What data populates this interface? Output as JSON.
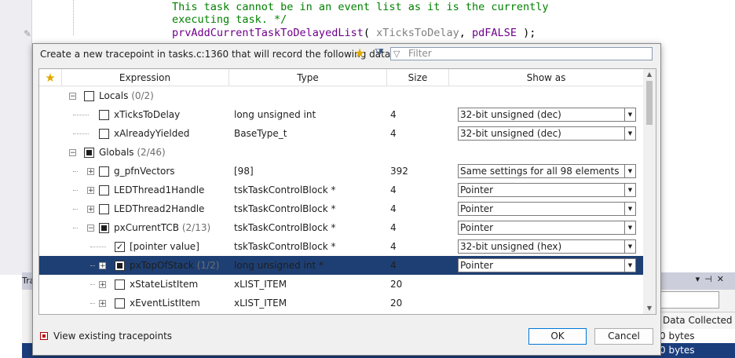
{
  "editor": {
    "lines": [
      {
        "parts": [
          {
            "t": "This task cannot be in an event list as it is the currently",
            "c": "c-comment"
          }
        ]
      },
      {
        "parts": [
          {
            "t": "executing task. */",
            "c": "c-comment"
          }
        ]
      },
      {
        "parts": [
          {
            "t": "prvAddCurrentTaskToDelayedList",
            "c": "c-fn"
          },
          {
            "t": "( ",
            "c": "c-punc"
          },
          {
            "t": "xTicksToDelay",
            "c": "c-param"
          },
          {
            "t": ", ",
            "c": "c-punc"
          },
          {
            "t": "pdFALSE",
            "c": "c-macro"
          },
          {
            "t": " );",
            "c": "c-punc"
          }
        ]
      }
    ]
  },
  "background_window": {
    "title_fragment": "Tra",
    "header_label": "Data Collected",
    "rows": [
      "0 bytes",
      "0 bytes"
    ]
  },
  "dialog": {
    "prompt": "Create a new tracepoint in tasks.c:1360 that will record the following data:",
    "filter_placeholder": "Filter",
    "columns": {
      "expression": "Expression",
      "type": "Type",
      "size": "Size",
      "show_as": "Show as"
    },
    "rows": [
      {
        "name": "Locals",
        "count": "(0/2)",
        "type": "",
        "size": "",
        "show_as": "",
        "level": 0,
        "expander": "minus",
        "check": "none",
        "selected": false
      },
      {
        "name": "xTicksToDelay",
        "count": "",
        "type": "long unsigned int",
        "size": "4",
        "show_as": "32-bit unsigned (dec)",
        "level": 1,
        "expander": "",
        "check": "none",
        "selected": false
      },
      {
        "name": "xAlreadyYielded",
        "count": "",
        "type": "BaseType_t",
        "size": "4",
        "show_as": "32-bit unsigned (dec)",
        "level": 1,
        "expander": "",
        "check": "none",
        "selected": false
      },
      {
        "name": "Globals",
        "count": "(2/46)",
        "type": "",
        "size": "",
        "show_as": "",
        "level": 0,
        "expander": "minus",
        "check": "partial",
        "selected": false
      },
      {
        "name": "g_pfnVectors",
        "count": "",
        "type": "[98]",
        "size": "392",
        "show_as": "Same settings for all 98 elements",
        "level": 1,
        "expander": "plus",
        "check": "none",
        "selected": false
      },
      {
        "name": "LEDThread1Handle",
        "count": "",
        "type": "tskTaskControlBlock *",
        "size": "4",
        "show_as": "Pointer",
        "level": 1,
        "expander": "plus",
        "check": "none",
        "selected": false
      },
      {
        "name": "LEDThread2Handle",
        "count": "",
        "type": "tskTaskControlBlock *",
        "size": "4",
        "show_as": "Pointer",
        "level": 1,
        "expander": "plus",
        "check": "none",
        "selected": false
      },
      {
        "name": "pxCurrentTCB",
        "count": "(2/13)",
        "type": "tskTaskControlBlock *",
        "size": "4",
        "show_as": "Pointer",
        "level": 1,
        "expander": "minus",
        "check": "partial",
        "selected": false
      },
      {
        "name": "[pointer value]",
        "count": "",
        "type": "tskTaskControlBlock *",
        "size": "4",
        "show_as": "32-bit unsigned (hex)",
        "level": 2,
        "expander": "",
        "check": "checked",
        "selected": false
      },
      {
        "name": "pxTopOfStack",
        "count": "(1/2)",
        "type": "long unsigned int *",
        "size": "4",
        "show_as": "Pointer",
        "level": 2,
        "expander": "plus",
        "check": "partial",
        "selected": true
      },
      {
        "name": "xStateListItem",
        "count": "",
        "type": "xLIST_ITEM",
        "size": "20",
        "show_as": "",
        "level": 2,
        "expander": "plus",
        "check": "none",
        "selected": false
      },
      {
        "name": "xEventListItem",
        "count": "",
        "type": "xLIST_ITEM",
        "size": "20",
        "show_as": "",
        "level": 2,
        "expander": "plus",
        "check": "none",
        "selected": false
      }
    ],
    "footer_link": "View existing tracepoints",
    "ok_label": "OK",
    "cancel_label": "Cancel"
  },
  "colors": {
    "selection": "#1e3f73",
    "comment": "#008000",
    "macro": "#6f008a"
  }
}
